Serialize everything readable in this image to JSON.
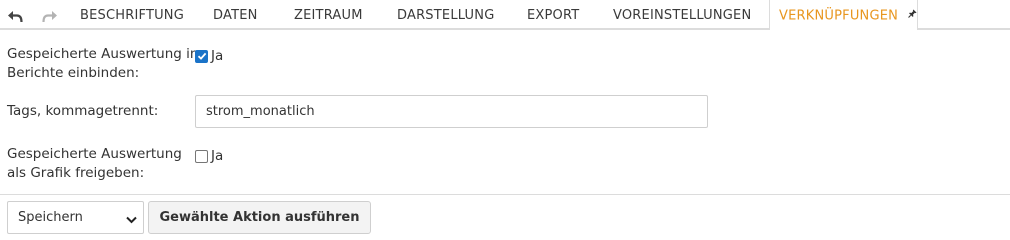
{
  "toolbar": {
    "undo_icon": "undo-icon",
    "redo_icon": "redo-icon"
  },
  "tabs": [
    {
      "label": "BESCHRIFTUNG"
    },
    {
      "label": "DATEN"
    },
    {
      "label": "ZEITRAUM"
    },
    {
      "label": "DARSTELLUNG"
    },
    {
      "label": "EXPORT"
    },
    {
      "label": "VOREINSTELLUNGEN"
    },
    {
      "label": "VERKNÜPFUNGEN",
      "active": true,
      "icon": "pin-icon"
    }
  ],
  "form": {
    "include_reports": {
      "label_line1": "Gespeicherte Auswertung in",
      "label_line2": "Berichte einbinden:",
      "checkbox_label": "Ja",
      "checked": true
    },
    "tags": {
      "label": "Tags, kommagetrennt:",
      "value": "strom_monatlich"
    },
    "share_graphic": {
      "label_line1": "Gespeicherte Auswertung",
      "label_line2": "als Grafik freigeben:",
      "checkbox_label": "Ja",
      "checked": false
    }
  },
  "footer": {
    "action_select": {
      "selected": "Speichern"
    },
    "execute_button": "Gewählte Aktion ausführen"
  },
  "colors": {
    "accent": "#e8961e",
    "checkbox": "#1a73c8",
    "border": "#dcdcdc"
  }
}
